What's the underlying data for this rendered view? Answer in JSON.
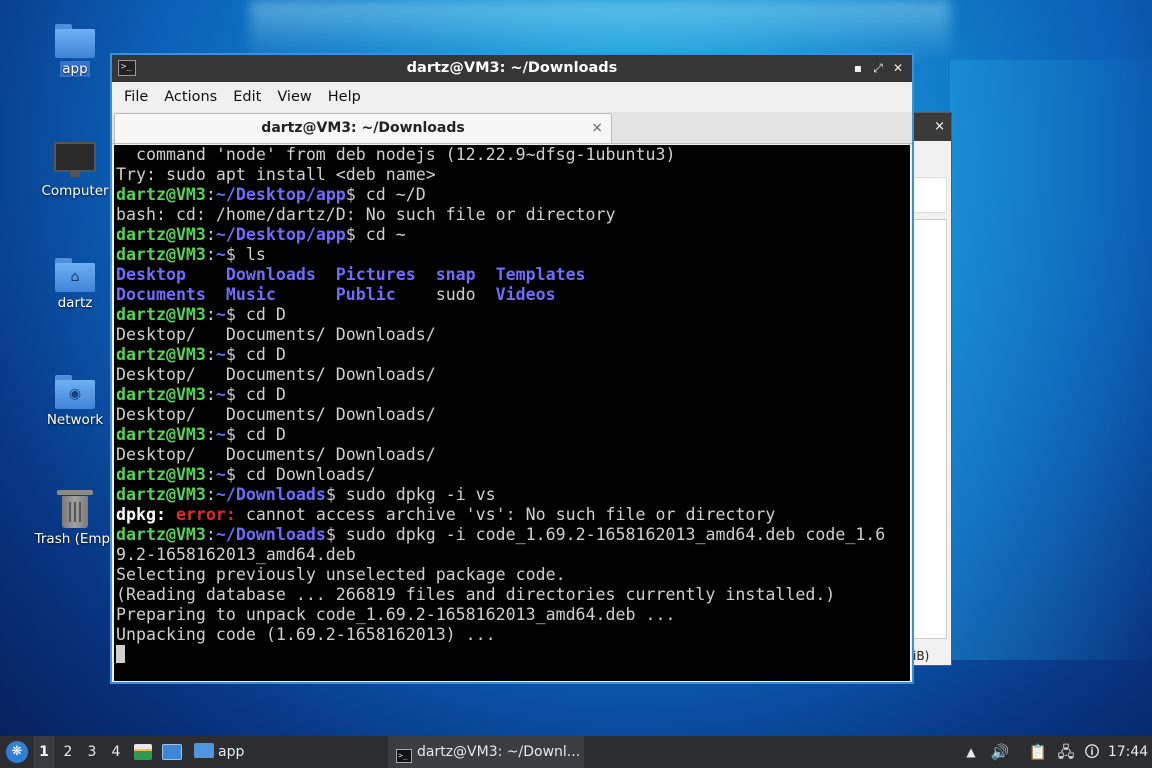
{
  "desktop": {
    "icons": [
      {
        "label": "app"
      },
      {
        "label": "Computer"
      },
      {
        "label": "dartz"
      },
      {
        "label": "Network"
      },
      {
        "label": "Trash (Empt"
      }
    ]
  },
  "background_window": {
    "close_glyph": "×",
    "footer_fragment": "iB)"
  },
  "terminal": {
    "title": "dartz@VM3: ~/Downloads",
    "title_icon": ">_",
    "window_buttons": {
      "minimize": "▪",
      "maximize": "⤢",
      "close": "✕"
    },
    "menu": [
      "File",
      "Actions",
      "Edit",
      "View",
      "Help"
    ],
    "tab": {
      "label": "dartz@VM3: ~/Downloads",
      "close": "×"
    },
    "lines": [
      [
        {
          "t": "  command 'node' from deb nodejs (12.22.9~dfsg-1ubuntu3)",
          "s": "c"
        }
      ],
      [
        {
          "t": "Try: sudo apt install <deb name>",
          "s": "c"
        }
      ],
      [
        {
          "t": "dartz@VM3",
          "s": "u"
        },
        {
          "t": ":",
          "s": "c"
        },
        {
          "t": "~/Desktop/app",
          "s": "p"
        },
        {
          "t": "$ cd ~/D",
          "s": "c"
        }
      ],
      [
        {
          "t": "bash: cd: /home/dartz/D: No such file or directory",
          "s": "c"
        }
      ],
      [
        {
          "t": "dartz@VM3",
          "s": "u"
        },
        {
          "t": ":",
          "s": "c"
        },
        {
          "t": "~/Desktop/app",
          "s": "p"
        },
        {
          "t": "$ cd ~",
          "s": "c"
        }
      ],
      [
        {
          "t": "dartz@VM3",
          "s": "u"
        },
        {
          "t": ":",
          "s": "c"
        },
        {
          "t": "~",
          "s": "p"
        },
        {
          "t": "$ ls",
          "s": "c"
        }
      ],
      [
        {
          "t": "Desktop    Downloads  Pictures  snap  Templates",
          "s": "d"
        }
      ],
      [
        {
          "t": "Documents  Music      Public    ",
          "s": "d"
        },
        {
          "t": "sudo  ",
          "s": "c"
        },
        {
          "t": "Videos",
          "s": "d"
        }
      ],
      [
        {
          "t": "dartz@VM3",
          "s": "u"
        },
        {
          "t": ":",
          "s": "c"
        },
        {
          "t": "~",
          "s": "p"
        },
        {
          "t": "$ cd D",
          "s": "c"
        }
      ],
      [
        {
          "t": "Desktop/   Documents/ Downloads/",
          "s": "c"
        }
      ],
      [
        {
          "t": "dartz@VM3",
          "s": "u"
        },
        {
          "t": ":",
          "s": "c"
        },
        {
          "t": "~",
          "s": "p"
        },
        {
          "t": "$ cd D",
          "s": "c"
        }
      ],
      [
        {
          "t": "Desktop/   Documents/ Downloads/",
          "s": "c"
        }
      ],
      [
        {
          "t": "dartz@VM3",
          "s": "u"
        },
        {
          "t": ":",
          "s": "c"
        },
        {
          "t": "~",
          "s": "p"
        },
        {
          "t": "$ cd D",
          "s": "c"
        }
      ],
      [
        {
          "t": "Desktop/   Documents/ Downloads/",
          "s": "c"
        }
      ],
      [
        {
          "t": "dartz@VM3",
          "s": "u"
        },
        {
          "t": ":",
          "s": "c"
        },
        {
          "t": "~",
          "s": "p"
        },
        {
          "t": "$ cd D",
          "s": "c"
        }
      ],
      [
        {
          "t": "Desktop/   Documents/ Downloads/",
          "s": "c"
        }
      ],
      [
        {
          "t": "dartz@VM3",
          "s": "u"
        },
        {
          "t": ":",
          "s": "c"
        },
        {
          "t": "~",
          "s": "p"
        },
        {
          "t": "$ cd Downloads/",
          "s": "c"
        }
      ],
      [
        {
          "t": "dartz@VM3",
          "s": "u"
        },
        {
          "t": ":",
          "s": "c"
        },
        {
          "t": "~/Downloads",
          "s": "p"
        },
        {
          "t": "$ sudo dpkg -i vs",
          "s": "c"
        }
      ],
      [
        {
          "t": "dpkg: ",
          "s": "w"
        },
        {
          "t": "error:",
          "s": "r"
        },
        {
          "t": " cannot access archive 'vs': No such file or directory",
          "s": "c"
        }
      ],
      [
        {
          "t": "dartz@VM3",
          "s": "u"
        },
        {
          "t": ":",
          "s": "c"
        },
        {
          "t": "~/Downloads",
          "s": "p"
        },
        {
          "t": "$ sudo dpkg -i code_1.69.2-1658162013_amd64.deb code_1.6",
          "s": "c"
        }
      ],
      [
        {
          "t": "9.2-1658162013_amd64.deb",
          "s": "c"
        }
      ],
      [
        {
          "t": "Selecting previously unselected package code.",
          "s": "c"
        }
      ],
      [
        {
          "t": "(Reading database ... 266819 files and directories currently installed.)",
          "s": "c"
        }
      ],
      [
        {
          "t": "Preparing to unpack code_1.69.2-1658162013_amd64.deb ...",
          "s": "c"
        }
      ],
      [
        {
          "t": "Unpacking code (1.69.2-1658162013) ...",
          "s": "c"
        }
      ]
    ]
  },
  "taskbar": {
    "start_glyph": "❋",
    "workspaces": [
      "1",
      "2",
      "3",
      "4"
    ],
    "current_workspace": "1",
    "quick_launch": [
      {
        "label": "app"
      }
    ],
    "task": {
      "label": "dartz@VM3: ~/Downl..."
    },
    "tray": {
      "up": "▲",
      "volume": "🔊",
      "clipboard": "📋",
      "network": "🖧",
      "updates": "🛈"
    },
    "clock": "17:44"
  },
  "colors": {
    "user": "#51d651",
    "path": "#6f6cff",
    "error": "#e02a2a",
    "accent": "#3e8fd8"
  }
}
